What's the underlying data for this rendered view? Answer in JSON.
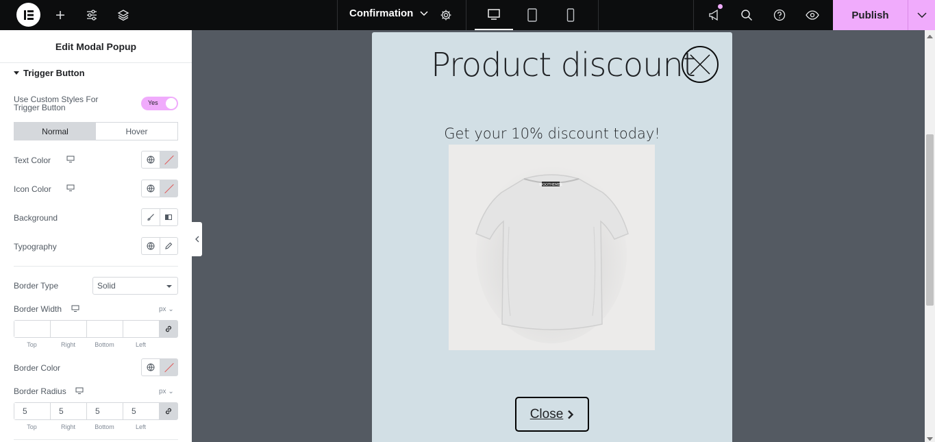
{
  "topbar": {
    "document_title": "Confirmation",
    "publish_label": "Publish"
  },
  "panel": {
    "title": "Edit Modal Popup",
    "section": "Trigger Button",
    "custom_styles_label": "Use Custom Styles For Trigger Button",
    "toggle_value": "Yes",
    "tabs": [
      "Normal",
      "Hover"
    ],
    "text_color_label": "Text Color",
    "icon_color_label": "Icon Color",
    "background_label": "Background",
    "typography_label": "Typography",
    "border_type_label": "Border Type",
    "border_type_value": "Solid",
    "border_width_label": "Border Width",
    "border_width_unit": "px",
    "border_color_label": "Border Color",
    "border_radius_label": "Border Radius",
    "border_radius_unit": "px",
    "dim_labels": [
      "Top",
      "Right",
      "Bottom",
      "Left"
    ],
    "border_width_values": [
      "",
      "",
      "",
      ""
    ],
    "border_radius_values": [
      "5",
      "5",
      "5",
      "5"
    ]
  },
  "popup": {
    "title": "Product discount",
    "subtitle": "Get your 10% discount today!",
    "shirt_print": "WOOTHEMES",
    "button_label": "Close"
  },
  "colors": {
    "accent": "#f0abfc",
    "topbar": "#0c0d0e",
    "canvas": "#545a62",
    "popup_bg": "#d2dfe5"
  }
}
